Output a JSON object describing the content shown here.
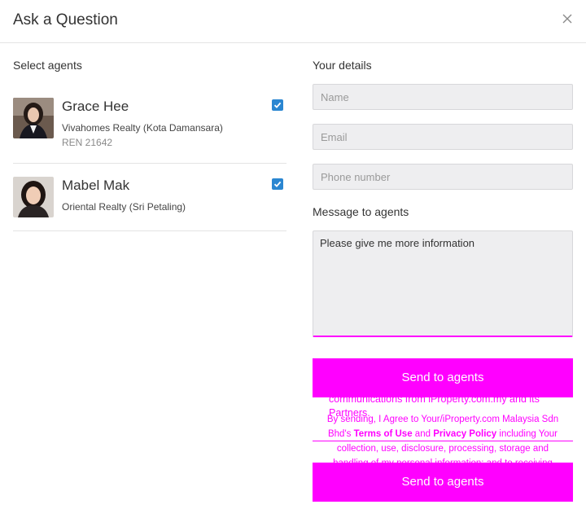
{
  "dialog": {
    "title": "Ask a Question"
  },
  "agents_panel": {
    "heading": "Select agents",
    "agents": [
      {
        "name": "Grace Hee",
        "agency": "Vivahomes Realty (Kota Damansara)",
        "ren": "REN 21642",
        "selected": true
      },
      {
        "name": "Mabel Mak",
        "agency": "Oriental Realty (Sri Petaling)",
        "selected": true
      }
    ]
  },
  "details": {
    "heading": "Your details",
    "name_placeholder": "Name",
    "email_placeholder": "Email",
    "phone_placeholder": "Phone number",
    "message_label": "Message to agents",
    "message_value": "Please give me more information"
  },
  "actions": {
    "send_label": "Send to agents",
    "send_label_bottom": "Send to agents"
  },
  "legal": {
    "ghost_text": "communications from iProperty.com.my and its Partners.",
    "prefix": "By sending, I Agree to Your/iProperty.com Malaysia Sdn Bhd's ",
    "terms": "Terms of Use",
    "and": " and ",
    "privacy": "Privacy Policy",
    "suffix": " including Your collection, use, disclosure, processing, storage and handling of my personal information; and to receiving"
  },
  "colors": {
    "accent": "#ff00ff",
    "checkbox": "#2a86d1"
  }
}
